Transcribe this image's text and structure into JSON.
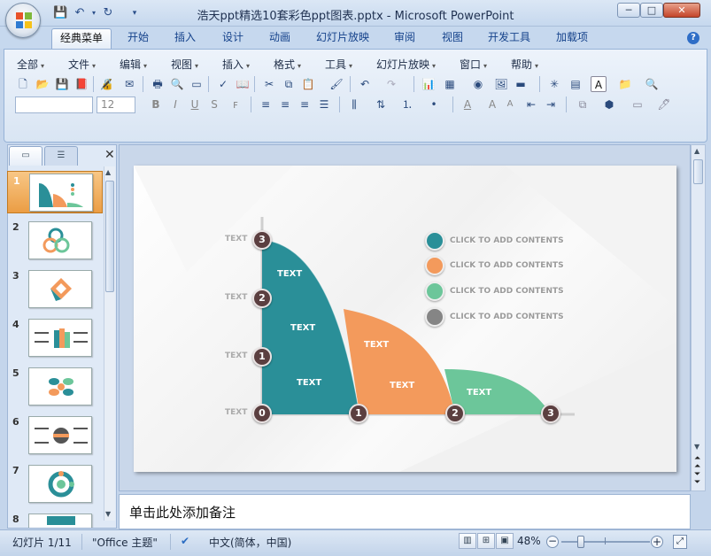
{
  "window": {
    "title": "浩天ppt精选10套彩色ppt图表.pptx - Microsoft PowerPoint",
    "minimize": "─",
    "maximize": "□",
    "close": "✕"
  },
  "quick_access": [
    "save",
    "undo",
    "redo"
  ],
  "ribbon_tabs": [
    {
      "label": "经典菜单",
      "active": true
    },
    {
      "label": "开始"
    },
    {
      "label": "插入"
    },
    {
      "label": "设计"
    },
    {
      "label": "动画"
    },
    {
      "label": "幻灯片放映"
    },
    {
      "label": "审阅"
    },
    {
      "label": "视图"
    },
    {
      "label": "开发工具"
    },
    {
      "label": "加载项"
    }
  ],
  "classic_menu": [
    "全部",
    "文件",
    "编辑",
    "视图",
    "插入",
    "格式",
    "工具",
    "幻灯片放映",
    "窗口",
    "帮助"
  ],
  "format_bar": {
    "font_name": "",
    "font_size": "12",
    "bold": "B",
    "italic": "I",
    "underline": "U",
    "shadow": "S",
    "font_color": "A"
  },
  "left_pane": {
    "tab_slides": "slides",
    "tab_outline": "outline",
    "close": "✕",
    "thumbnails": [
      "1",
      "2",
      "3",
      "4",
      "5",
      "6",
      "7",
      "8"
    ],
    "selected": "1"
  },
  "slide": {
    "y_labels": [
      "TEXT",
      "TEXT",
      "TEXT",
      "TEXT"
    ],
    "y_markers": [
      "3",
      "2",
      "1",
      "0"
    ],
    "x_markers": [
      "1",
      "2",
      "3"
    ],
    "area_labels": [
      "TEXT",
      "TEXT",
      "TEXT",
      "TEXT",
      "TEXT",
      "TEXT"
    ],
    "legend": [
      {
        "text": "CLICK TO ADD CONTENTS",
        "color": "#2a8f98"
      },
      {
        "text": "CLICK TO ADD CONTENTS",
        "color": "#f39a5c"
      },
      {
        "text": "CLICK TO ADD CONTENTS",
        "color": "#6cc69a"
      },
      {
        "text": "CLICK TO ADD CONTENTS",
        "color": "#858585"
      }
    ],
    "colors": {
      "teal": "#2a8f98",
      "orange": "#f39a5c",
      "green": "#6cc69a",
      "marker": "#5a3e3e"
    }
  },
  "notes_placeholder": "单击此处添加备注",
  "status": {
    "slide_info": "幻灯片 1/11",
    "theme": "\"Office 主题\"",
    "language": "中文(简体，中国)",
    "zoom": "48%"
  }
}
